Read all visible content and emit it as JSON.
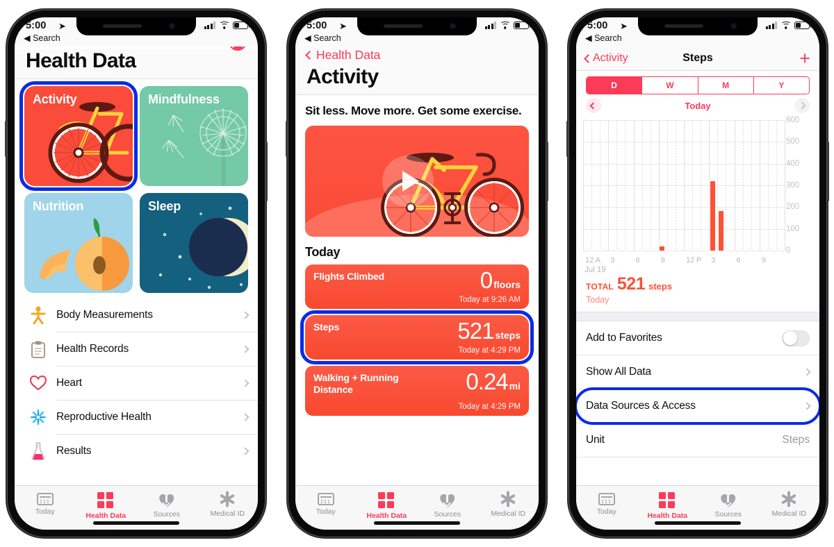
{
  "colors": {
    "accent_pink": "#FB3B58",
    "highlight_blue": "#0B2BE8",
    "activity_red": "#FB4B3A",
    "mindfulness_green": "#74C9A7",
    "nutrition_blue": "#9FD4EA",
    "sleep_navy": "#14607F",
    "bar_orange": "#FB5236"
  },
  "status_bar": {
    "time": "5:00",
    "location_icon": "location-arrow-icon",
    "back_label": "Search",
    "signal_icon": "cellular-signal-icon",
    "wifi_icon": "wifi-icon",
    "battery_icon": "battery-icon"
  },
  "phone1": {
    "profile_icon": "profile-icon",
    "title": "Health Data",
    "tiles": [
      {
        "label": "Activity",
        "art": "bicycle-illustration",
        "selected": true
      },
      {
        "label": "Mindfulness",
        "art": "dandelion-illustration",
        "selected": false
      },
      {
        "label": "Nutrition",
        "art": "peach-illustration",
        "selected": false
      },
      {
        "label": "Sleep",
        "art": "moon-stars-illustration",
        "selected": false
      }
    ],
    "rows": [
      {
        "label": "Body Measurements",
        "icon": "body-figure-icon"
      },
      {
        "label": "Health Records",
        "icon": "clipboard-icon"
      },
      {
        "label": "Heart",
        "icon": "heart-icon"
      },
      {
        "label": "Reproductive Health",
        "icon": "flower-burst-icon"
      },
      {
        "label": "Results",
        "icon": "flask-icon"
      }
    ]
  },
  "phone2": {
    "back_label": "Health Data",
    "title": "Activity",
    "headline": "Sit less. Move more. Get some exercise.",
    "video_card": {
      "art": "bicycle-illustration",
      "play_icon": "play-icon"
    },
    "section_title": "Today",
    "cards": [
      {
        "title": "Flights Climbed",
        "value": "0",
        "unit": "floors",
        "time": "Today at 9:26 AM",
        "selected": false
      },
      {
        "title": "Steps",
        "value": "521",
        "unit": "steps",
        "time": "Today at 4:29 PM",
        "selected": true
      },
      {
        "title": "Walking + Running Distance",
        "value": "0.24",
        "unit": "mi",
        "time": "Today at 4:29 PM",
        "selected": false
      }
    ]
  },
  "phone3": {
    "back_label": "Activity",
    "title": "Steps",
    "add_icon": "plus-icon",
    "segments": [
      {
        "label": "D",
        "selected": true
      },
      {
        "label": "W",
        "selected": false
      },
      {
        "label": "M",
        "selected": false
      },
      {
        "label": "Y",
        "selected": false
      }
    ],
    "day_nav": {
      "prev_icon": "chevron-left-icon",
      "label": "Today",
      "next_icon": "chevron-right-icon"
    },
    "total": {
      "label": "TOTAL",
      "value": "521",
      "unit": "steps",
      "sub": "Today"
    },
    "rows": [
      {
        "label": "Add to Favorites",
        "control": "toggle",
        "value": "",
        "selected": false
      },
      {
        "label": "Show All Data",
        "control": "chevron",
        "value": "",
        "selected": false
      },
      {
        "label": "Data Sources & Access",
        "control": "chevron",
        "value": "",
        "selected": true
      },
      {
        "label": "Unit",
        "control": "value",
        "value": "Steps",
        "selected": false
      }
    ]
  },
  "tabbar": {
    "tabs": [
      {
        "label": "Today",
        "icon": "calendar-icon",
        "active": false
      },
      {
        "label": "Health Data",
        "icon": "grid-icon",
        "active": true
      },
      {
        "label": "Sources",
        "icon": "heart-download-icon",
        "active": false
      },
      {
        "label": "Medical ID",
        "icon": "medical-asterisk-icon",
        "active": false
      }
    ]
  },
  "chart_data": {
    "type": "bar",
    "title": "Steps",
    "subtitle": "Today",
    "xlabel": "Jul 19",
    "ylabel": "steps",
    "ylim": [
      0,
      600
    ],
    "yticks": [
      0,
      100,
      200,
      300,
      400,
      500,
      600
    ],
    "xticks": [
      "12 A",
      "3",
      "6",
      "9",
      "12 P",
      "3",
      "6",
      "9"
    ],
    "x_date": "Jul 19",
    "grid": true,
    "legend": "none",
    "bar_color": "#FB5236",
    "total": 521,
    "total_unit": "steps",
    "x": [
      "9 AM",
      "3 PM",
      "4 PM"
    ],
    "values": [
      20,
      318,
      183
    ],
    "points": [
      {
        "hour": 9,
        "label": "9 AM",
        "value": 20
      },
      {
        "hour": 15,
        "label": "3 PM",
        "value": 318
      },
      {
        "hour": 16,
        "label": "4 PM",
        "value": 183
      }
    ]
  }
}
